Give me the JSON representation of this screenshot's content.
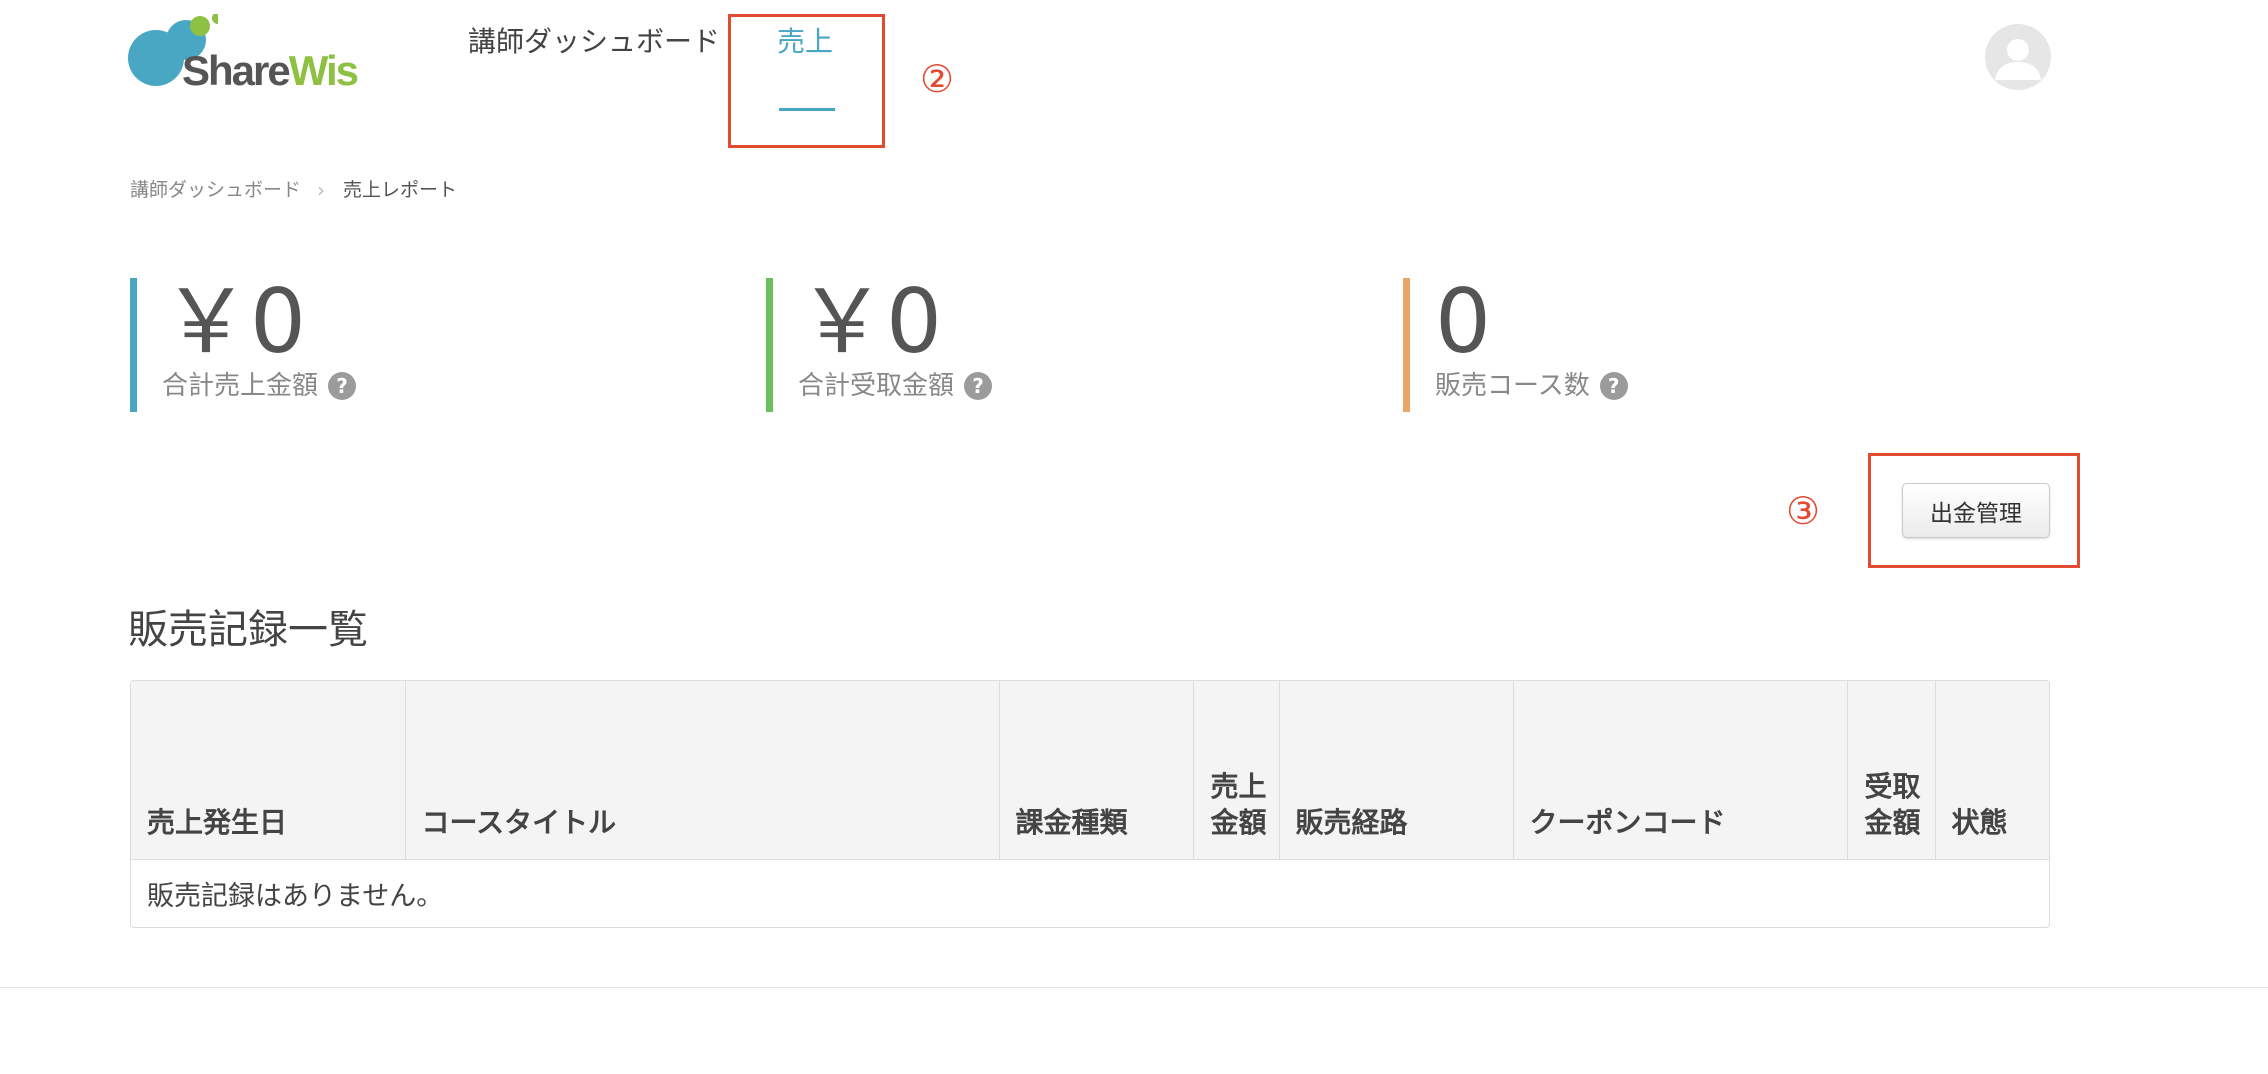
{
  "header": {
    "logo": {
      "part1": "Share",
      "part2": "Wis"
    },
    "nav": [
      {
        "label": "講師ダッシュボード"
      },
      {
        "label": "売上"
      }
    ],
    "annotations": [
      "②",
      "③"
    ]
  },
  "breadcrumb": {
    "items": [
      "講師ダッシュボード",
      "売上レポート"
    ],
    "separator": "›"
  },
  "stats": [
    {
      "value": "￥0",
      "label": "合計売上金額",
      "accent": "#4aa7c3"
    },
    {
      "value": "￥0",
      "label": "合計受取金額",
      "accent": "#6abf5e"
    },
    {
      "value": "0",
      "label": "販売コース数",
      "accent": "#e9a667"
    }
  ],
  "help_glyph": "?",
  "withdraw_button": {
    "label": "出金管理"
  },
  "sales_table": {
    "title": "販売記録一覧",
    "headers": [
      "売上発生日",
      "コースタイトル",
      "課金種類",
      "売上金額",
      "販売経路",
      "クーポンコード",
      "受取金額",
      "状態"
    ],
    "empty_message": "販売記録はありません。"
  },
  "colors": {
    "brand_blue": "#4aa7c3",
    "brand_green": "#8dc043",
    "annotation_red": "#e24b32"
  }
}
